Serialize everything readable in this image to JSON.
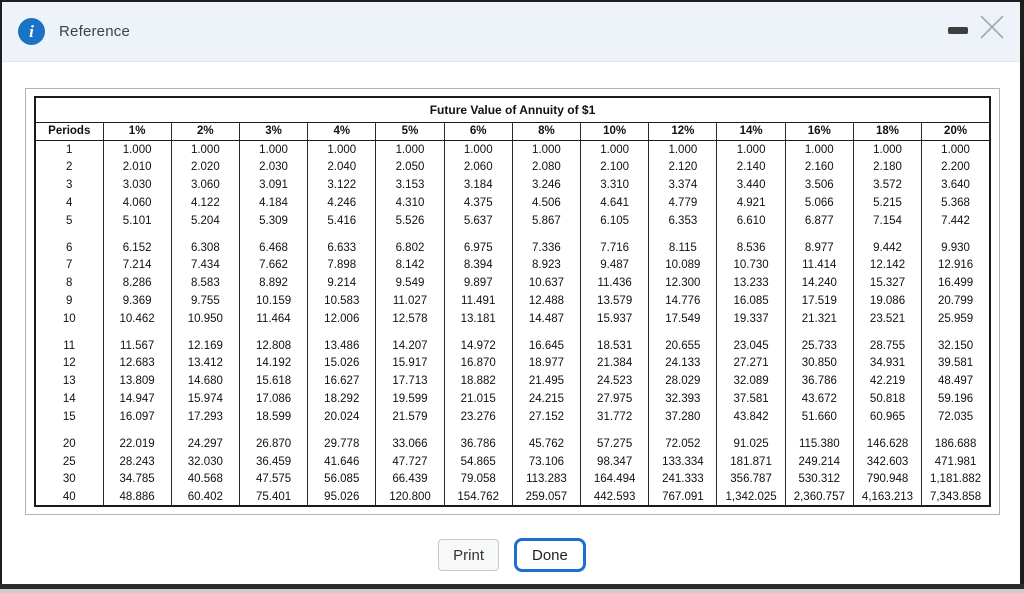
{
  "header": {
    "title": "Reference",
    "info_icon_glyph": "i",
    "icons": [
      "info-icon",
      "minimize-icon",
      "close-icon"
    ]
  },
  "colors": {
    "titlebar_bg": "#eef3f9",
    "info_icon_blue": "#1a73c4",
    "done_border_blue": "#1c6fd1",
    "table_border": "#1a1a1a",
    "frame_dark": "#1e1e1e"
  },
  "table": {
    "title": "Future Value of Annuity of $1",
    "columns": [
      "Periods",
      "1%",
      "2%",
      "3%",
      "4%",
      "5%",
      "6%",
      "8%",
      "10%",
      "12%",
      "14%",
      "16%",
      "18%",
      "20%"
    ],
    "groups": [
      [
        [
          "1",
          "1.000",
          "1.000",
          "1.000",
          "1.000",
          "1.000",
          "1.000",
          "1.000",
          "1.000",
          "1.000",
          "1.000",
          "1.000",
          "1.000",
          "1.000"
        ],
        [
          "2",
          "2.010",
          "2.020",
          "2.030",
          "2.040",
          "2.050",
          "2.060",
          "2.080",
          "2.100",
          "2.120",
          "2.140",
          "2.160",
          "2.180",
          "2.200"
        ],
        [
          "3",
          "3.030",
          "3.060",
          "3.091",
          "3.122",
          "3.153",
          "3.184",
          "3.246",
          "3.310",
          "3.374",
          "3.440",
          "3.506",
          "3.572",
          "3.640"
        ],
        [
          "4",
          "4.060",
          "4.122",
          "4.184",
          "4.246",
          "4.310",
          "4.375",
          "4.506",
          "4.641",
          "4.779",
          "4.921",
          "5.066",
          "5.215",
          "5.368"
        ],
        [
          "5",
          "5.101",
          "5.204",
          "5.309",
          "5.416",
          "5.526",
          "5.637",
          "5.867",
          "6.105",
          "6.353",
          "6.610",
          "6.877",
          "7.154",
          "7.442"
        ]
      ],
      [
        [
          "6",
          "6.152",
          "6.308",
          "6.468",
          "6.633",
          "6.802",
          "6.975",
          "7.336",
          "7.716",
          "8.115",
          "8.536",
          "8.977",
          "9.442",
          "9.930"
        ],
        [
          "7",
          "7.214",
          "7.434",
          "7.662",
          "7.898",
          "8.142",
          "8.394",
          "8.923",
          "9.487",
          "10.089",
          "10.730",
          "11.414",
          "12.142",
          "12.916"
        ],
        [
          "8",
          "8.286",
          "8.583",
          "8.892",
          "9.214",
          "9.549",
          "9.897",
          "10.637",
          "11.436",
          "12.300",
          "13.233",
          "14.240",
          "15.327",
          "16.499"
        ],
        [
          "9",
          "9.369",
          "9.755",
          "10.159",
          "10.583",
          "11.027",
          "11.491",
          "12.488",
          "13.579",
          "14.776",
          "16.085",
          "17.519",
          "19.086",
          "20.799"
        ],
        [
          "10",
          "10.462",
          "10.950",
          "11.464",
          "12.006",
          "12.578",
          "13.181",
          "14.487",
          "15.937",
          "17.549",
          "19.337",
          "21.321",
          "23.521",
          "25.959"
        ]
      ],
      [
        [
          "11",
          "11.567",
          "12.169",
          "12.808",
          "13.486",
          "14.207",
          "14.972",
          "16.645",
          "18.531",
          "20.655",
          "23.045",
          "25.733",
          "28.755",
          "32.150"
        ],
        [
          "12",
          "12.683",
          "13.412",
          "14.192",
          "15.026",
          "15.917",
          "16.870",
          "18.977",
          "21.384",
          "24.133",
          "27.271",
          "30.850",
          "34.931",
          "39.581"
        ],
        [
          "13",
          "13.809",
          "14.680",
          "15.618",
          "16.627",
          "17.713",
          "18.882",
          "21.495",
          "24.523",
          "28.029",
          "32.089",
          "36.786",
          "42.219",
          "48.497"
        ],
        [
          "14",
          "14.947",
          "15.974",
          "17.086",
          "18.292",
          "19.599",
          "21.015",
          "24.215",
          "27.975",
          "32.393",
          "37.581",
          "43.672",
          "50.818",
          "59.196"
        ],
        [
          "15",
          "16.097",
          "17.293",
          "18.599",
          "20.024",
          "21.579",
          "23.276",
          "27.152",
          "31.772",
          "37.280",
          "43.842",
          "51.660",
          "60.965",
          "72.035"
        ]
      ],
      [
        [
          "20",
          "22.019",
          "24.297",
          "26.870",
          "29.778",
          "33.066",
          "36.786",
          "45.762",
          "57.275",
          "72.052",
          "91.025",
          "115.380",
          "146.628",
          "186.688"
        ],
        [
          "25",
          "28.243",
          "32.030",
          "36.459",
          "41.646",
          "47.727",
          "54.865",
          "73.106",
          "98.347",
          "133.334",
          "181.871",
          "249.214",
          "342.603",
          "471.981"
        ],
        [
          "30",
          "34.785",
          "40.568",
          "47.575",
          "56.085",
          "66.439",
          "79.058",
          "113.283",
          "164.494",
          "241.333",
          "356.787",
          "530.312",
          "790.948",
          "1,181.882"
        ],
        [
          "40",
          "48.886",
          "60.402",
          "75.401",
          "95.026",
          "120.800",
          "154.762",
          "259.057",
          "442.593",
          "767.091",
          "1,342.025",
          "2,360.757",
          "4,163.213",
          "7,343.858"
        ]
      ]
    ]
  },
  "buttons": {
    "print": "Print",
    "done": "Done"
  }
}
